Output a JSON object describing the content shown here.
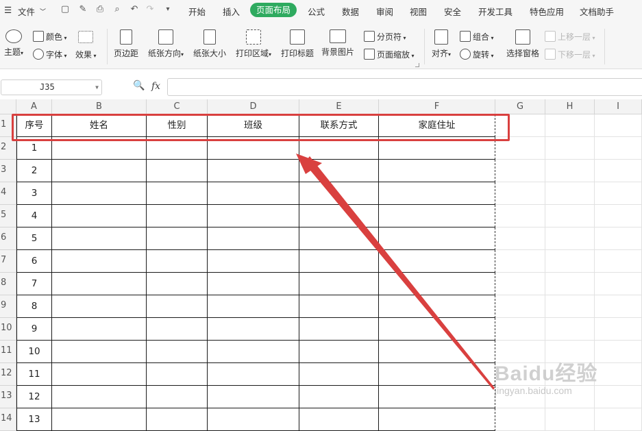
{
  "menubar": {
    "file_label": "文件",
    "tabs": [
      "开始",
      "插入",
      "页面布局",
      "公式",
      "数据",
      "审阅",
      "视图",
      "安全",
      "开发工具",
      "特色应用",
      "文档助手"
    ],
    "active_tab": "页面布局"
  },
  "ribbon": {
    "theme": "主题",
    "colors": "颜色",
    "font": "字体",
    "effects": "效果",
    "margins": "页边距",
    "orientation": "纸张方向",
    "size": "纸张大小",
    "print_area": "打印区域",
    "print_titles": "打印标题",
    "background": "背景图片",
    "page_break": "分页符",
    "page_zoom": "页面缩放",
    "align": "对齐",
    "group": "组合",
    "rotate": "旋转",
    "selection_pane": "选择窗格",
    "bring_forward": "上移一层",
    "send_backward": "下移一层"
  },
  "formula": {
    "name_box": "J35",
    "fx": "fx",
    "value": ""
  },
  "sheet": {
    "columns": [
      "A",
      "B",
      "C",
      "D",
      "E",
      "F",
      "G",
      "H",
      "I"
    ],
    "rows": [
      "1",
      "2",
      "3",
      "4",
      "5",
      "6",
      "7",
      "8",
      "9",
      "10",
      "11",
      "12",
      "13",
      "14"
    ],
    "headers": [
      "序号",
      "姓名",
      "性别",
      "班级",
      "联系方式",
      "家庭住址"
    ],
    "serials": [
      "1",
      "2",
      "3",
      "4",
      "5",
      "6",
      "7",
      "8",
      "9",
      "10",
      "11",
      "12",
      "13"
    ]
  },
  "watermark": {
    "brand": "Baidu经验",
    "url": "jingyan.baidu.com"
  },
  "colors": {
    "accent": "#2eaa5f",
    "highlight": "#d9403f",
    "arrow": "#d9403f"
  }
}
